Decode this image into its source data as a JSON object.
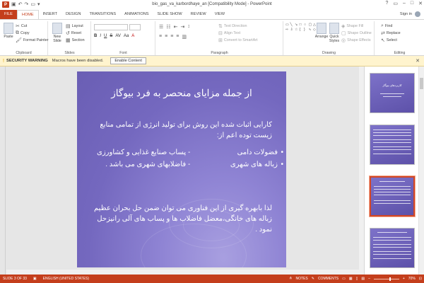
{
  "window": {
    "title": "bio_gas_va_karbordhaye_an [Compatibility Mode] - PowerPoint",
    "app_icon": "P",
    "controls": [
      "?",
      "▭",
      "–",
      "□",
      "✕"
    ]
  },
  "ribbon": {
    "tabs": [
      "FILE",
      "HOME",
      "INSERT",
      "DESIGN",
      "TRANSITIONS",
      "ANIMATIONS",
      "SLIDE SHOW",
      "REVIEW",
      "VIEW"
    ],
    "active_tab": "HOME",
    "sign_in": "Sign in",
    "clipboard": {
      "paste": "Paste",
      "cut": "Cut",
      "copy": "Copy",
      "format_painter": "Format Painter",
      "label": "Clipboard"
    },
    "slides": {
      "new_slide": "New Slide",
      "layout": "Layout",
      "reset": "Reset",
      "section": "Section",
      "label": "Slides"
    },
    "font": {
      "bold": "B",
      "italic": "I",
      "underline": "U",
      "strike": "S",
      "spacing": "AV",
      "case": "Aa",
      "color": "A",
      "label": "Font"
    },
    "paragraph": {
      "text_direction": "Text Direction",
      "align_text": "Align Text",
      "convert_smartart": "Convert to SmartArt",
      "label": "Paragraph"
    },
    "drawing": {
      "arrange": "Arrange",
      "quick_styles": "Quick Styles",
      "shape_fill": "Shape Fill",
      "shape_outline": "Shape Outline",
      "shape_effects": "Shape Effects",
      "label": "Drawing"
    },
    "editing": {
      "find": "Find",
      "replace": "Replace",
      "select": "Select",
      "label": "Editing"
    }
  },
  "security_bar": {
    "title": "SECURITY WARNING",
    "message": "Macros have been disabled.",
    "button": "Enable Content"
  },
  "slide": {
    "title": "از جمله مزایای منحصر به فرد بیوگاز",
    "intro_line1": "کارایی اثبات شده این روش برای تولید انرژی از تمامی منابع",
    "intro_line2": "زیست توده اعم از:",
    "items": [
      "فضولات دامی",
      "- پساب صنایع غذایی و کشاورزی",
      "زباله های شهری",
      "- فاضلابهای شهری  می باشد ."
    ],
    "outro_line1": "لذا بابهره گیری از این فناوری می  توان ضمن حل بحران عظیم",
    "outro_line2": "زباله های خانگی،معضل فاضلاب ها و پساب های آلی رانیزحل",
    "outro_line3": "نمود ."
  },
  "thumbnails": {
    "numbers": [
      "1",
      "2",
      "3",
      "4"
    ],
    "selected": "3",
    "t1_title": "کاربردهای بیوگاز"
  },
  "status": {
    "slide_count": "SLIDE 3 OF 33",
    "language": "ENGLISH (UNITED STATES)",
    "notes": "NOTES",
    "comments": "COMMENTS",
    "zoom": "70%"
  }
}
